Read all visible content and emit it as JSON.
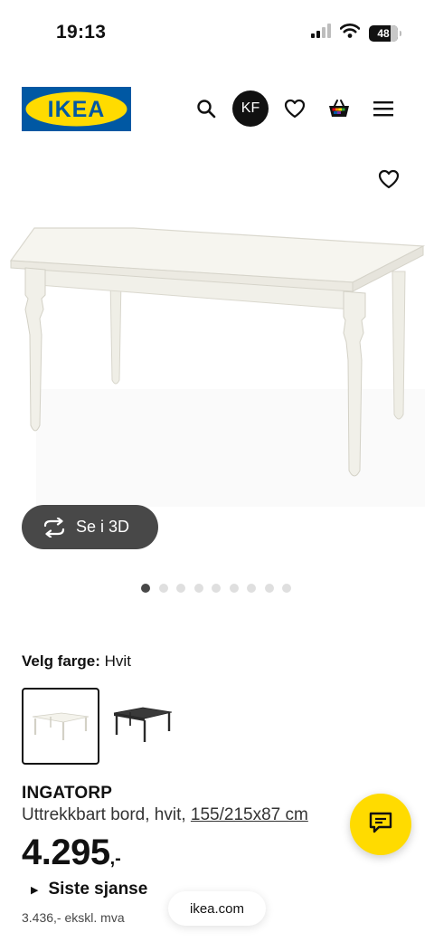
{
  "status_bar": {
    "time": "19:13",
    "battery_level": "48"
  },
  "header": {
    "logo_text": "IKEA",
    "avatar_initials": "KF",
    "icons": [
      "search-icon",
      "heart-icon",
      "basket-icon",
      "menu-icon"
    ]
  },
  "gallery": {
    "view_3d_label": "Se i 3D",
    "image_count": 9,
    "active_index": 0
  },
  "color_selector": {
    "label": "Velg farge:",
    "selected_value": "Hvit",
    "options": [
      "Hvit",
      "Svart"
    ]
  },
  "product": {
    "name": "INGATORP",
    "description": "Uttrekkbart bord, hvit, ",
    "dimensions": "155/215x87 cm",
    "price_main": "4.295",
    "price_suffix": ",-",
    "last_chance": "Siste sjanse",
    "price_excl_vat": "3.436,- ekskl. mva"
  },
  "browser": {
    "url": "ikea.com"
  },
  "colors": {
    "ikea_blue": "#0058a3",
    "ikea_yellow": "#ffdb00",
    "pill_dark": "#484848"
  }
}
